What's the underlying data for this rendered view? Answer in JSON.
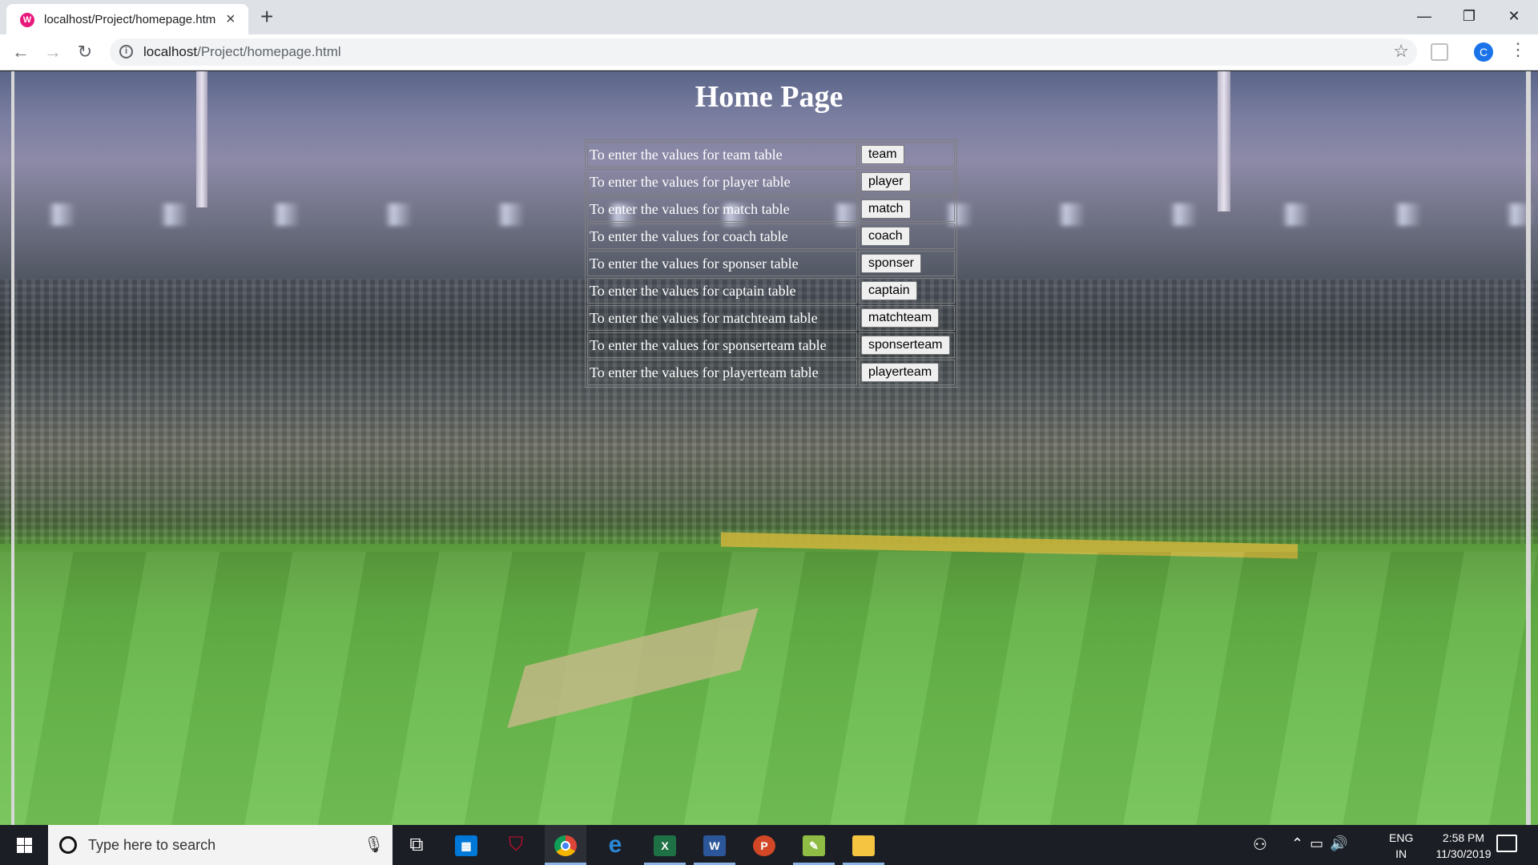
{
  "browser": {
    "tab_title": "localhost/Project/homepage.htm",
    "url_host": "localhost",
    "url_path": "/Project/homepage.html",
    "profile_initial": "C",
    "favicon_letter": "W"
  },
  "page": {
    "title": "Home Page",
    "rows": [
      {
        "label": "To enter the values for team table",
        "button": "team"
      },
      {
        "label": "To enter the values for player table",
        "button": "player"
      },
      {
        "label": "To enter the values for match table",
        "button": "match"
      },
      {
        "label": "To enter the values for coach table",
        "button": "coach"
      },
      {
        "label": "To enter the values for sponser table",
        "button": "sponser"
      },
      {
        "label": "To enter the values for captain table",
        "button": "captain"
      },
      {
        "label": "To enter the values for matchteam table",
        "button": "matchteam"
      },
      {
        "label": "To enter the values for sponserteam table",
        "button": "sponserteam"
      },
      {
        "label": "To enter the values for playerteam table",
        "button": "playerteam"
      }
    ]
  },
  "taskbar": {
    "search_placeholder": "Type here to search",
    "lang_line1": "ENG",
    "lang_line2": "IN",
    "time": "2:58 PM",
    "date": "11/30/2019",
    "apps": [
      "task-view",
      "store",
      "mcafee",
      "chrome",
      "edge",
      "excel",
      "word",
      "powerpoint",
      "notepad",
      "file-explorer"
    ]
  },
  "colors": {
    "title_text": "#ffffff",
    "table_border": "#808080",
    "taskbar_bg": "#1b1e24",
    "profile_blue": "#1a73e8"
  }
}
